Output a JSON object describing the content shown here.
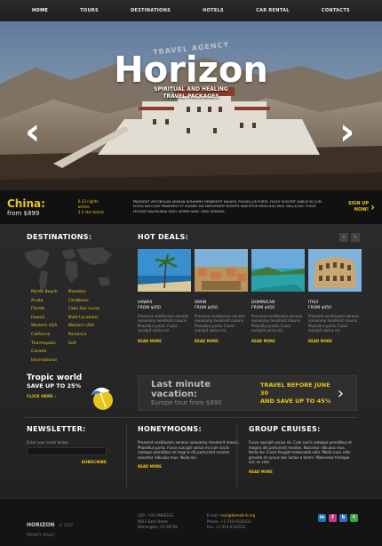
{
  "nav": {
    "items": [
      "HOME",
      "TOURS",
      "DESTINATIONS",
      "HOTELS",
      "CAR RENTAL",
      "CONTACTS"
    ]
  },
  "hero": {
    "agency": "TRAVEL AGENCY",
    "brand": "Horizon",
    "tagline1": "SPIRITUAL AND HEALING",
    "tagline2": "TRAVEL PACKAGES",
    "prev_icon": "chevron-left-icon",
    "next_icon": "chevron-right-icon"
  },
  "promo": {
    "destination": "China:",
    "price": "from $899",
    "info1": "6-23 nights",
    "info2": "airfare",
    "info3": "3-5 star hotels",
    "description": "PRAESENT VESTIBULUM AENEAN NONUMMY HENDRERIT MAURIS. PHASELLUS PORTA. FUSCE SUSCIPIT VARIUS MI CUM SOCIIS NATOQUE PENATIBUS ET MAGNIS DIS PARTURIENT MONTES NASCETUR RIDICULUS MUS. NULLA DUI. FUSCE FEUGIAT MALESUADA ODIO. MORBI NUNC ODIO GRAVIDA.",
    "signup1": "SIGN UP",
    "signup2": "NOW!"
  },
  "destinations": {
    "title": "DESTINATIONS:",
    "col1": [
      "Myrtle Beach",
      "Aruba",
      "Florida",
      "Hawaii",
      "Western USA",
      "California",
      "Thermopolis",
      "Canada",
      "International"
    ],
    "col2": [
      "Mazatlan",
      "Caribbean",
      "Cabo San Lucas",
      "Multi-Locations",
      "Western USA",
      "Romance",
      "Golf"
    ]
  },
  "hot_deals": {
    "title": "HOT DEALS:",
    "items": [
      {
        "name": "HAWAII",
        "price": "FROM $450",
        "desc": "Praesent vestibulum aenean nonummy hendrerit mauris. Phasellus porta. Fusce suscipit varius mi.",
        "more": "READ MORE"
      },
      {
        "name": "SPAIN",
        "price": "FROM $450",
        "desc": "Praesent vestibulum aenean nonummy hendrerit mauris. Phasellus porta. Fusce suscipit varius mi.",
        "more": "READ MORE"
      },
      {
        "name": "DOMINICAN",
        "price": "FROM $450",
        "desc": "Praesent vestibulum aenean nonummy hendrerit mauris. Phasellus porta. Fusce suscipit varius mi.",
        "more": "READ MORE"
      },
      {
        "name": "ITALY",
        "price": "FROM $450",
        "desc": "Praesent vestibulum aenean nonummy hendrerit mauris. Phasellus porta. Fusce suscipit varius mi.",
        "more": "READ MORE"
      }
    ]
  },
  "tropic": {
    "title": "Tropic world",
    "save": "SAVE UP TO 25%",
    "click": "CLICK HERE ›"
  },
  "lastmin": {
    "title": "Last minute vacation:",
    "sub": "Europe tour from $890",
    "offer1": "TRAVEL BEFORE JUNE 30",
    "offer2": "AND SAVE UP TO 45%"
  },
  "newsletter": {
    "title": "NEWSLETTER:",
    "label": "Enter your email below:",
    "subscribe": "SUBSCRIBE"
  },
  "honeymoons": {
    "title": "HONEYMOONS:",
    "text": "Praesent vestibulum aenean nonummy hendrerit mauris. Phasellus porta. Fusce suscipit varius mi cum sociis natoque penatibus et magnis dis parturient montes nascetur ridiculus mus. Nulla dui.",
    "more": "READ MORE"
  },
  "cruises": {
    "title": "GROUP CRUISES:",
    "text": "Fusce suscipit varius mi. Cum sociis natoque penatibus et magnis dis parturient montes. Nascetur ridiculus mus. Nulla dui. Fusce feugiat malesuada odio. Morbi nunc odio gravida at cursus nec luctus a lorem. Maecenas tristique orci ac sem.",
    "more": "READ MORE"
  },
  "footer": {
    "brand": "HORIZON",
    "year": "© 2012",
    "privacy": "PRIVACY POLICY",
    "addr1": "USA - LOS ANGELES",
    "addr2": "9011 East Street",
    "addr3": "Wilmington, CA 90744",
    "email_label": "E-mail:",
    "email": "mail@demolink.org",
    "phone": "Phone: +1-310-0334102",
    "fax": "Fax: +1-310-0334552",
    "social": [
      "in",
      "f",
      "b",
      "t"
    ]
  },
  "colors": {
    "accent": "#e8c51a",
    "bg": "#1e1e1e"
  }
}
